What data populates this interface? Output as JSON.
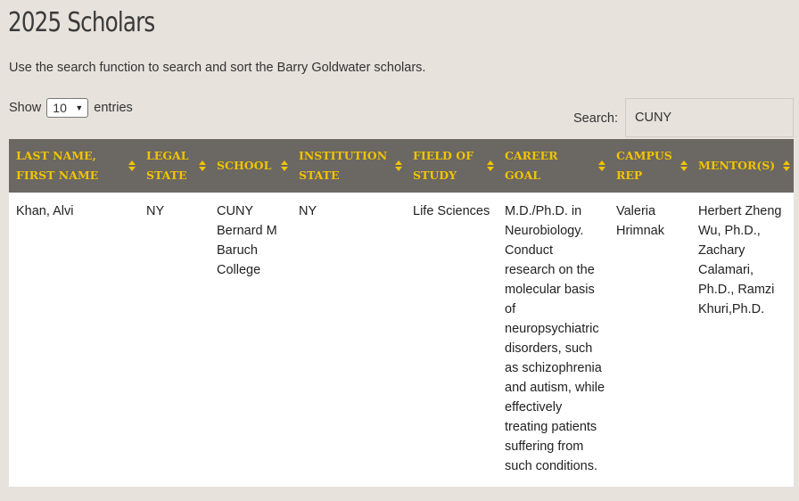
{
  "page": {
    "title": "2025 Scholars",
    "intro": "Use the search function to search and sort the Barry Goldwater scholars."
  },
  "length_control": {
    "show_label": "Show",
    "selected": "10",
    "entries_label": "entries"
  },
  "search": {
    "label": "Search:",
    "value": "CUNY"
  },
  "table": {
    "columns": [
      "LAST NAME, FIRST NAME",
      "LEGAL STATE",
      "SCHOOL",
      "INSTITUTION STATE",
      "FIELD OF STUDY",
      "CAREER GOAL",
      "CAMPUS REP",
      "MENTOR(S)"
    ],
    "rows": [
      {
        "name": "Khan, Alvi",
        "legal_state": "NY",
        "school": "CUNY Bernard M Baruch College",
        "institution_state": "NY",
        "field": "Life Sciences",
        "career_goal": "M.D./Ph.D. in Neurobiology. Conduct research on the molecular basis of neuropsychiatric disorders, such as schizophrenia and autism, while effectively treating patients suffering from such conditions.",
        "campus_rep": "Valeria Hrimnak",
        "mentors": "Herbert Zheng Wu, Ph.D., Zachary Calamari, Ph.D., Ramzi Khuri,Ph.D."
      }
    ]
  },
  "colors": {
    "background": "#e7e2dc",
    "header_bg": "#6b6762",
    "header_text": "#f1c400"
  },
  "icons": {
    "sort": "sort-both-icon",
    "select_chevron": "chevron-down-icon"
  }
}
